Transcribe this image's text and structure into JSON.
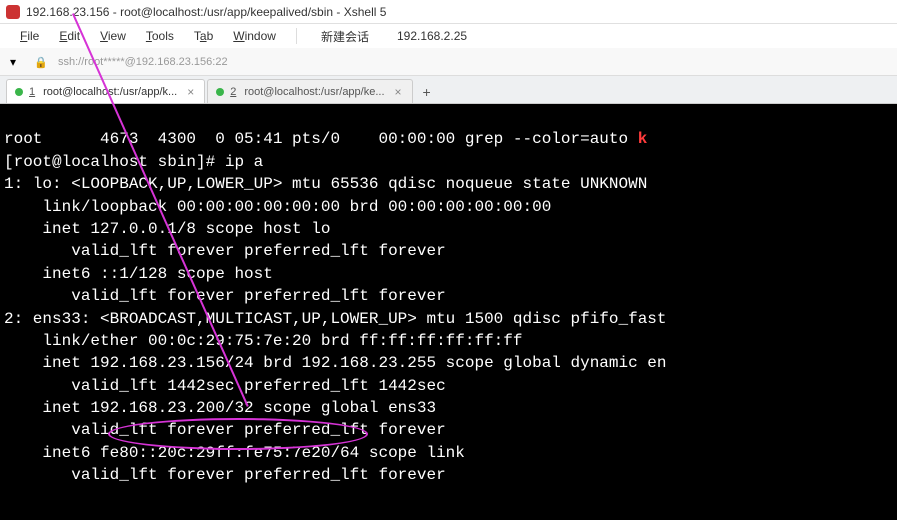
{
  "window": {
    "title": "192.168.23.156 - root@localhost:/usr/app/keepalived/sbin - Xshell 5"
  },
  "menu": {
    "file": "File",
    "edit": "Edit",
    "view": "View",
    "tools": "Tools",
    "tab": "Tab",
    "window": "Window",
    "new_session": "新建会话",
    "ip": "192.168.2.25"
  },
  "connection": {
    "text": "ssh://root*****@192.168.23.156:22"
  },
  "tabs": {
    "active": {
      "num": "1",
      "label": "root@localhost:/usr/app/k..."
    },
    "inactive": {
      "num": "2",
      "label": "root@localhost:/usr/app/ke..."
    },
    "add": "+"
  },
  "terminal": {
    "lines": [
      "root      4673  4300  0 05:41 pts/0    00:00:00 grep --color=auto ",
      "[root@localhost sbin]# ip a",
      "1: lo: <LOOPBACK,UP,LOWER_UP> mtu 65536 qdisc noqueue state UNKNOWN ",
      "    link/loopback 00:00:00:00:00:00 brd 00:00:00:00:00:00",
      "    inet 127.0.0.1/8 scope host lo",
      "       valid_lft forever preferred_lft forever",
      "    inet6 ::1/128 scope host",
      "       valid_lft forever preferred_lft forever",
      "2: ens33: <BROADCAST,MULTICAST,UP,LOWER_UP> mtu 1500 qdisc pfifo_fast",
      "    link/ether 00:0c:29:75:7e:20 brd ff:ff:ff:ff:ff:ff",
      "    inet 192.168.23.156/24 brd 192.168.23.255 scope global dynamic en",
      "       valid_lft 1442sec preferred_lft 1442sec",
      "    inet 192.168.23.200/32 scope global ens33",
      "       valid_lft forever preferred_lft forever",
      "    inet6 fe80::20c:29ff:fe75:7e20/64 scope link",
      "       valid_lft forever preferred_lft forever"
    ],
    "trailing_red": "k"
  },
  "annotation": {
    "highlighted_ip": "192.168.23.200/32",
    "colors": {
      "magenta": "#d633d6"
    }
  }
}
